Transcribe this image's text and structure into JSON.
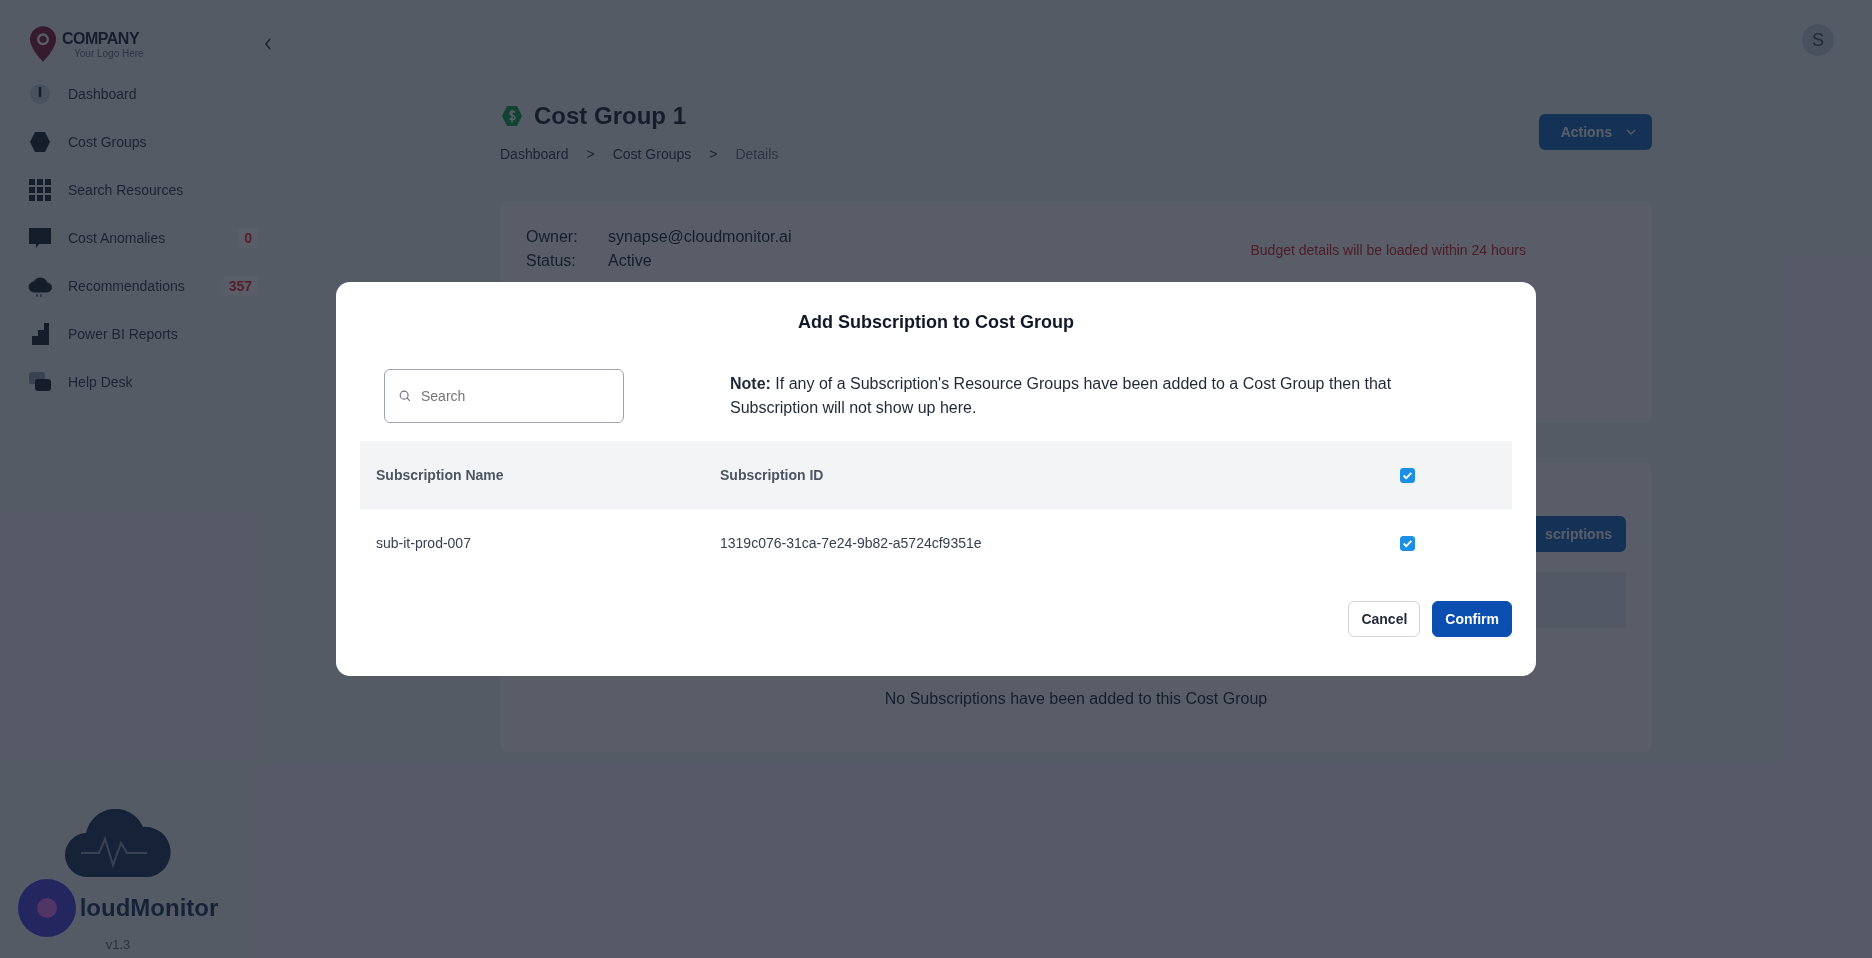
{
  "logo": {
    "name": "COMPANY",
    "tagline": "Your Logo Here"
  },
  "sidebar": {
    "items": [
      {
        "label": "Dashboard",
        "kind": "gauge"
      },
      {
        "label": "Cost Groups",
        "kind": "hexagon"
      },
      {
        "label": "Search Resources",
        "kind": "grid"
      },
      {
        "label": "Cost Anomalies",
        "kind": "chat",
        "badge": "0"
      },
      {
        "label": "Recommendations",
        "kind": "cloud",
        "badge": "357"
      },
      {
        "label": "Power BI Reports",
        "kind": "steps"
      },
      {
        "label": "Help Desk",
        "kind": "help"
      }
    ]
  },
  "user": {
    "initial": "S"
  },
  "page": {
    "title": "Cost Group 1",
    "breadcrumbs": [
      {
        "label": "Dashboard",
        "current": false
      },
      {
        "label": "Cost Groups",
        "current": false
      },
      {
        "label": "Details",
        "current": true
      }
    ],
    "breadcrumb_separator": ">",
    "actions": "Actions",
    "details": [
      {
        "label": "Owner:",
        "value": "synapse@cloudmonitor.ai"
      },
      {
        "label": "Status:",
        "value": "Active"
      }
    ],
    "budget_note": "Budget details will be loaded within 24 hours",
    "add_button": "scriptions",
    "empty_message": "No Subscriptions have been added to this Cost Group"
  },
  "footer": {
    "product": "loudMonitor",
    "version": "v1.3"
  },
  "modal": {
    "title": "Add Subscription to Cost Group",
    "search": {
      "placeholder": "Search"
    },
    "note": "**Note:** If any of a Subscription's Resource Groups have been added to a Cost Group then that Subscription will not show up here.",
    "table": {
      "columns": [
        "Subscription Name",
        "Subscription ID"
      ],
      "select_all_checked": true,
      "rows": [
        {
          "name": "sub-it-prod-007",
          "id": "1319c076-31ca-7e24-9b82-a5724cf9351e",
          "checked": true
        }
      ]
    },
    "buttons": [
      {
        "label": "Cancel",
        "kind": "secondary"
      },
      {
        "label": "Confirm",
        "kind": "primary"
      }
    ]
  }
}
